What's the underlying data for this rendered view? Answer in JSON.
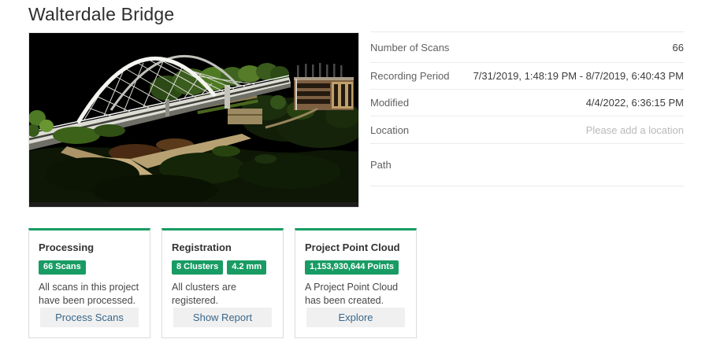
{
  "page": {
    "title": "Walterdale Bridge"
  },
  "preview": {
    "name": "point-cloud-preview"
  },
  "details": {
    "rows": [
      {
        "label": "Number of Scans",
        "value": "66"
      },
      {
        "label": "Recording Period",
        "value": "7/31/2019, 1:48:19 PM - 8/7/2019, 6:40:43 PM"
      },
      {
        "label": "Modified",
        "value": "4/4/2022, 6:36:15 PM"
      },
      {
        "label": "Location",
        "value": "",
        "placeholder": "Please add a location"
      },
      {
        "label": "Path",
        "value": ""
      }
    ]
  },
  "cards": [
    {
      "title": "Processing",
      "badges": [
        "66 Scans"
      ],
      "text": "All scans in this project have been processed.",
      "button": "Process Scans"
    },
    {
      "title": "Registration",
      "badges": [
        "8 Clusters",
        "4.2 mm"
      ],
      "text": "All clusters are registered.",
      "button": "Show Report"
    },
    {
      "title": "Project Point Cloud",
      "badges": [
        "1,153,930,644 Points"
      ],
      "text": "A Project Point Cloud has been created.",
      "button": "Explore"
    }
  ],
  "colors": {
    "accent_green": "#189c64",
    "button_text_blue": "#38678a",
    "divider": "#ebebeb"
  }
}
